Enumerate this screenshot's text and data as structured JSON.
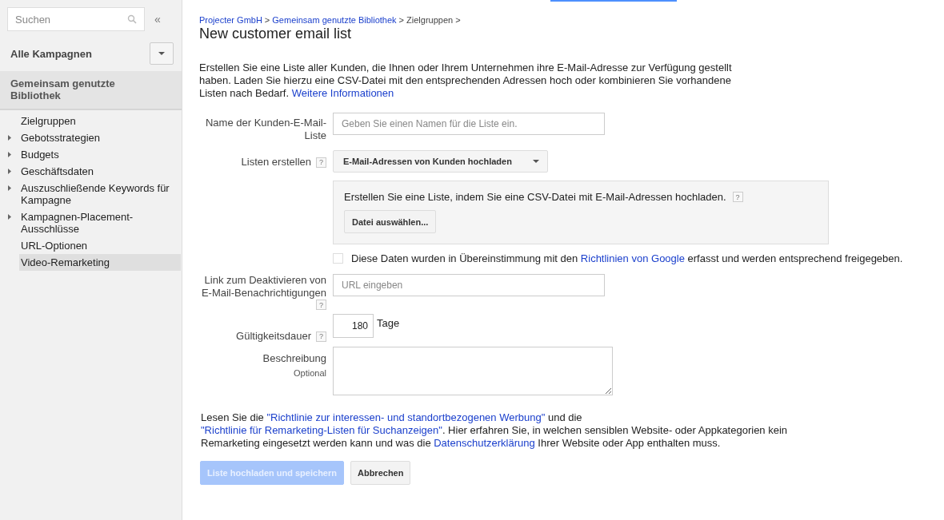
{
  "sidebar": {
    "search": {
      "placeholder": "Suchen"
    },
    "collapse_label": "«",
    "campaigns_label": "Alle Kampagnen",
    "section_title": "Gemeinsam genutzte Bibliothek",
    "items": [
      {
        "label": "Zielgruppen",
        "collapsed": false,
        "selected": false
      },
      {
        "label": "Gebotsstrategien",
        "collapsed": true,
        "selected": false
      },
      {
        "label": "Budgets",
        "collapsed": true,
        "selected": false
      },
      {
        "label": "Geschäftsdaten",
        "collapsed": true,
        "selected": false
      },
      {
        "label": "Auszuschließende Keywords für Kampagne",
        "collapsed": true,
        "selected": false
      },
      {
        "label": "Kampagnen-Placement-Ausschlüsse",
        "collapsed": true,
        "selected": false
      },
      {
        "label": "URL-Optionen",
        "collapsed": false,
        "selected": false
      },
      {
        "label": "Video-Remarketing",
        "collapsed": false,
        "selected": true
      }
    ]
  },
  "breadcrumb_separator": ">",
  "breadcrumb": [
    {
      "text": "Projecter GmbH",
      "link": true
    },
    {
      "text": "Gemeinsam genutzte Bibliothek",
      "link": true
    },
    {
      "text": "Zielgruppen",
      "link": false
    }
  ],
  "title": "New customer email list",
  "intro": [
    {
      "text": "Erstellen Sie eine Liste aller Kunden, die Ihnen oder Ihrem Unternehmen ihre E-Mail-Adresse zur Verfügung gestellt haben. Laden Sie hierzu eine CSV-Datei mit den entsprechenden Adressen hoch oder kombinieren Sie vorhandene Listen nach Bedarf. ",
      "link": false
    },
    {
      "text": "Weitere Informationen",
      "link": true
    }
  ],
  "form": {
    "name_label": "Name der Kunden-E-Mail-Liste",
    "name_placeholder": "Geben Sie einen Namen für die Liste ein.",
    "create_label": "Listen erstellen",
    "create_value": "E-Mail-Adressen von Kunden hochladen",
    "upload_text": "Erstellen Sie eine Liste, indem Sie eine CSV-Datei mit E-Mail-Adressen hochladen.",
    "upload_button": "Datei auswählen...",
    "consent": {
      "checked": false,
      "segments": [
        {
          "text": "Diese Daten wurden in Übereinstimmung mit den ",
          "link": false
        },
        {
          "text": "Richtlinien von Google",
          "link": true
        },
        {
          "text": " erfasst und werden entsprechend freigegeben.",
          "link": false
        }
      ]
    },
    "optout_label": "Link zum Deaktivieren von E-Mail-Benachrichtigungen",
    "optout_placeholder": "URL eingeben",
    "duration_label": "Gültigkeitsdauer",
    "duration_value": "180",
    "duration_unit": "Tage",
    "description_label": "Beschreibung",
    "description_hint": "Optional",
    "help_mark": "?"
  },
  "policy": [
    {
      "text": "Lesen Sie die ",
      "link": false
    },
    {
      "text": "\"Richtlinie zur interessen- und standortbezogenen Werbung\"",
      "link": true
    },
    {
      "text": " und die ",
      "link": false
    },
    {
      "text": "\"Richtlinie für Remarketing-Listen für Suchanzeigen\"",
      "link": true
    },
    {
      "text": ". Hier erfahren Sie, in welchen sensiblen Website- oder Appkategorien kein Remarketing eingesetzt werden kann und was die ",
      "link": false
    },
    {
      "text": "Datenschutzerklärung",
      "link": true
    },
    {
      "text": " Ihrer Website oder App enthalten muss.",
      "link": false
    }
  ],
  "buttons": [
    {
      "label": "Liste hochladen und speichern",
      "kind": "primary",
      "disabled": true
    },
    {
      "label": "Abbrechen",
      "kind": "secondary",
      "disabled": false
    }
  ]
}
